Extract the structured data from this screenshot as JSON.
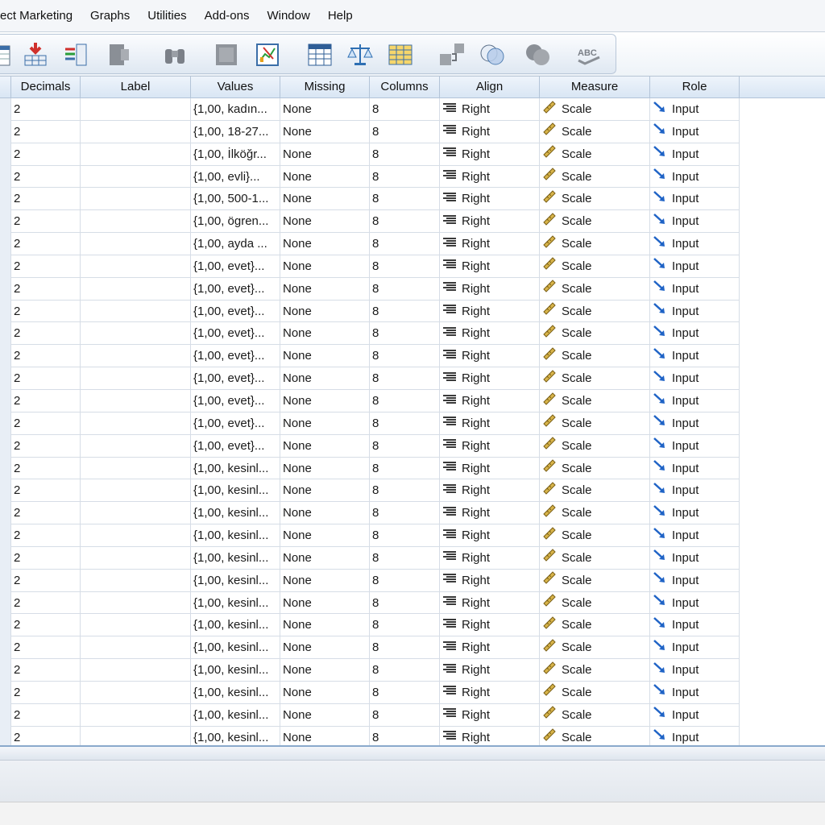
{
  "menu": [
    "ect Marketing",
    "Graphs",
    "Utilities",
    "Add-ons",
    "Window",
    "Help"
  ],
  "toolbar_icons": [
    "variable-sheet-icon",
    "insert-cases-icon",
    "insert-variable-icon",
    "split-file-icon",
    "find-binoculars-icon",
    "select-cases-icon",
    "chart-builder-icon",
    "value-labels-icon",
    "weight-cases-icon",
    "use-sets-icon",
    "show-all-variables-icon",
    "venn-icon",
    "circles-icon",
    "spell-check-icon"
  ],
  "columns": [
    "Decimals",
    "Label",
    "Values",
    "Missing",
    "Columns",
    "Align",
    "Measure",
    "Role"
  ],
  "rows": [
    {
      "decimals": "2",
      "label": "",
      "values": "{1,00, kadın...",
      "missing": "None",
      "columns": "8",
      "align": "Right",
      "measure": "Scale",
      "role": "Input"
    },
    {
      "decimals": "2",
      "label": "",
      "values": "{1,00, 18-27...",
      "missing": "None",
      "columns": "8",
      "align": "Right",
      "measure": "Scale",
      "role": "Input"
    },
    {
      "decimals": "2",
      "label": "",
      "values": "{1,00, İlköğr...",
      "missing": "None",
      "columns": "8",
      "align": "Right",
      "measure": "Scale",
      "role": "Input"
    },
    {
      "decimals": "2",
      "label": "",
      "values": "{1,00, evli}...",
      "missing": "None",
      "columns": "8",
      "align": "Right",
      "measure": "Scale",
      "role": "Input"
    },
    {
      "decimals": "2",
      "label": "",
      "values": "{1,00, 500-1...",
      "missing": "None",
      "columns": "8",
      "align": "Right",
      "measure": "Scale",
      "role": "Input"
    },
    {
      "decimals": "2",
      "label": "",
      "values": "{1,00, ögren...",
      "missing": "None",
      "columns": "8",
      "align": "Right",
      "measure": "Scale",
      "role": "Input"
    },
    {
      "decimals": "2",
      "label": "",
      "values": "{1,00, ayda ...",
      "missing": "None",
      "columns": "8",
      "align": "Right",
      "measure": "Scale",
      "role": "Input"
    },
    {
      "decimals": "2",
      "label": "",
      "values": "{1,00, evet}...",
      "missing": "None",
      "columns": "8",
      "align": "Right",
      "measure": "Scale",
      "role": "Input"
    },
    {
      "decimals": "2",
      "label": "",
      "values": "{1,00, evet}...",
      "missing": "None",
      "columns": "8",
      "align": "Right",
      "measure": "Scale",
      "role": "Input"
    },
    {
      "decimals": "2",
      "label": "",
      "values": "{1,00, evet}...",
      "missing": "None",
      "columns": "8",
      "align": "Right",
      "measure": "Scale",
      "role": "Input"
    },
    {
      "decimals": "2",
      "label": "",
      "values": "{1,00, evet}...",
      "missing": "None",
      "columns": "8",
      "align": "Right",
      "measure": "Scale",
      "role": "Input"
    },
    {
      "decimals": "2",
      "label": "",
      "values": "{1,00, evet}...",
      "missing": "None",
      "columns": "8",
      "align": "Right",
      "measure": "Scale",
      "role": "Input"
    },
    {
      "decimals": "2",
      "label": "",
      "values": "{1,00, evet}...",
      "missing": "None",
      "columns": "8",
      "align": "Right",
      "measure": "Scale",
      "role": "Input"
    },
    {
      "decimals": "2",
      "label": "",
      "values": "{1,00, evet}...",
      "missing": "None",
      "columns": "8",
      "align": "Right",
      "measure": "Scale",
      "role": "Input"
    },
    {
      "decimals": "2",
      "label": "",
      "values": "{1,00, evet}...",
      "missing": "None",
      "columns": "8",
      "align": "Right",
      "measure": "Scale",
      "role": "Input"
    },
    {
      "decimals": "2",
      "label": "",
      "values": "{1,00, evet}...",
      "missing": "None",
      "columns": "8",
      "align": "Right",
      "measure": "Scale",
      "role": "Input"
    },
    {
      "decimals": "2",
      "label": "",
      "values": "{1,00, kesinl...",
      "missing": "None",
      "columns": "8",
      "align": "Right",
      "measure": "Scale",
      "role": "Input"
    },
    {
      "decimals": "2",
      "label": "",
      "values": "{1,00, kesinl...",
      "missing": "None",
      "columns": "8",
      "align": "Right",
      "measure": "Scale",
      "role": "Input"
    },
    {
      "decimals": "2",
      "label": "",
      "values": "{1,00, kesinl...",
      "missing": "None",
      "columns": "8",
      "align": "Right",
      "measure": "Scale",
      "role": "Input"
    },
    {
      "decimals": "2",
      "label": "",
      "values": "{1,00, kesinl...",
      "missing": "None",
      "columns": "8",
      "align": "Right",
      "measure": "Scale",
      "role": "Input"
    },
    {
      "decimals": "2",
      "label": "",
      "values": "{1,00, kesinl...",
      "missing": "None",
      "columns": "8",
      "align": "Right",
      "measure": "Scale",
      "role": "Input"
    },
    {
      "decimals": "2",
      "label": "",
      "values": "{1,00, kesinl...",
      "missing": "None",
      "columns": "8",
      "align": "Right",
      "measure": "Scale",
      "role": "Input"
    },
    {
      "decimals": "2",
      "label": "",
      "values": "{1,00, kesinl...",
      "missing": "None",
      "columns": "8",
      "align": "Right",
      "measure": "Scale",
      "role": "Input"
    },
    {
      "decimals": "2",
      "label": "",
      "values": "{1,00, kesinl...",
      "missing": "None",
      "columns": "8",
      "align": "Right",
      "measure": "Scale",
      "role": "Input"
    },
    {
      "decimals": "2",
      "label": "",
      "values": "{1,00, kesinl...",
      "missing": "None",
      "columns": "8",
      "align": "Right",
      "measure": "Scale",
      "role": "Input"
    },
    {
      "decimals": "2",
      "label": "",
      "values": "{1,00, kesinl...",
      "missing": "None",
      "columns": "8",
      "align": "Right",
      "measure": "Scale",
      "role": "Input"
    },
    {
      "decimals": "2",
      "label": "",
      "values": "{1,00, kesinl...",
      "missing": "None",
      "columns": "8",
      "align": "Right",
      "measure": "Scale",
      "role": "Input"
    },
    {
      "decimals": "2",
      "label": "",
      "values": "{1,00, kesinl...",
      "missing": "None",
      "columns": "8",
      "align": "Right",
      "measure": "Scale",
      "role": "Input"
    },
    {
      "decimals": "2",
      "label": "",
      "values": "{1,00, kesinl...",
      "missing": "None",
      "columns": "8",
      "align": "Right",
      "measure": "Scale",
      "role": "Input"
    }
  ],
  "icons": {
    "align": "align-right-icon",
    "measure": "scale-ruler-icon",
    "role": "input-arrow-icon"
  },
  "colors": {
    "header_bg": "#dbe7f4",
    "grid_line": "#d6dde6",
    "role_arrow": "#1f63c6",
    "ruler": "#c9a53a"
  }
}
